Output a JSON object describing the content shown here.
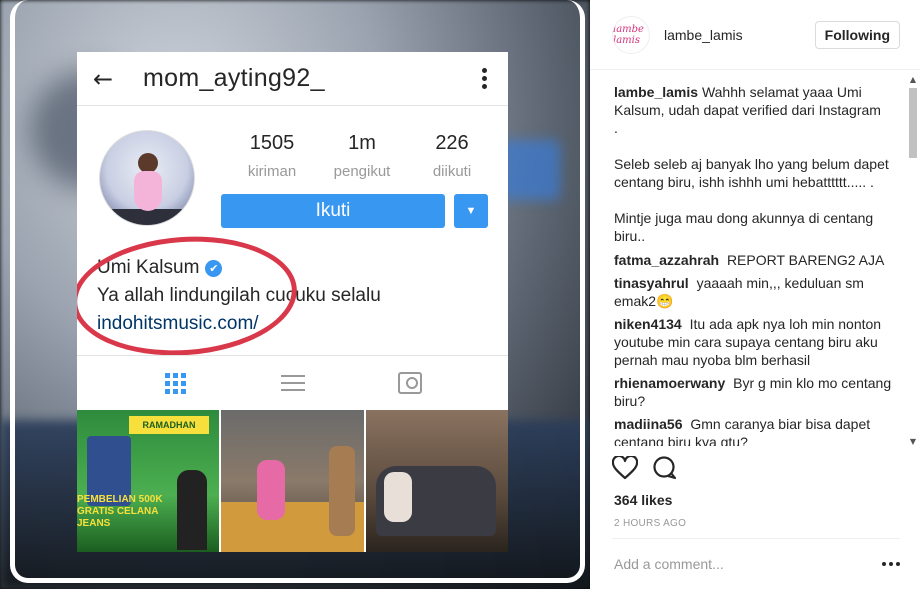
{
  "post_image": {
    "screenshot": {
      "username": "mom_ayting92_",
      "stats": [
        {
          "value": "1505",
          "label": "kiriman"
        },
        {
          "value": "1m",
          "label": "pengikut"
        },
        {
          "value": "226",
          "label": "diikuti"
        }
      ],
      "follow_label": "Ikuti",
      "dropdown_icon": "▼",
      "bio_name": "Umi Kalsum",
      "verified_glyph": "✔",
      "bio_text": "Ya allah lindungilah cucuku selalu",
      "bio_link": "indohitsmusic.com/",
      "thumb1_banner": "RAMADHAN",
      "thumb1_promo": "PEMBELIAN 500K GRATIS CELANA JEANS"
    },
    "colors": {
      "accent": "#3897f0",
      "highlight_oval": "#d9384a"
    }
  },
  "panel": {
    "header": {
      "avatar_text": "lambe lamis",
      "username": "lambe_lamis",
      "following_label": "Following"
    },
    "caption": {
      "user": "lambe_lamis",
      "lines": [
        "Wahhh selamat yaaa Umi Kalsum, udah dapat verified dari Instagram",
        ".",
        "Seleb seleb aj banyak lho yang belum dapet centang biru, ishh ishhh umi hebatttttt..... .",
        "Mintje juga mau dong akunnya di centang biru.."
      ]
    },
    "comments": [
      {
        "user": "fatma_azzahrah",
        "text": "REPORT BARENG2 AJA"
      },
      {
        "user": "tinasyahrul",
        "text": "yaaaah min,,, keduluan sm emak2😁"
      },
      {
        "user": "niken4134",
        "text": "Itu ada apk nya loh min nonton youtube min cara supaya centang biru aku pernah mau nyoba blm berhasil"
      },
      {
        "user": "rhienamoerwany",
        "text": "Byr g min klo mo centang biru?"
      },
      {
        "user": "madiina56",
        "text": "Gmn caranya biar bisa dapet centang biru kya gtu?"
      }
    ],
    "likes": "364 likes",
    "time_ago": "2 HOURS AGO",
    "add_comment_placeholder": "Add a comment...",
    "icons": [
      "heart-icon",
      "comment-icon",
      "more-options-icon"
    ]
  }
}
